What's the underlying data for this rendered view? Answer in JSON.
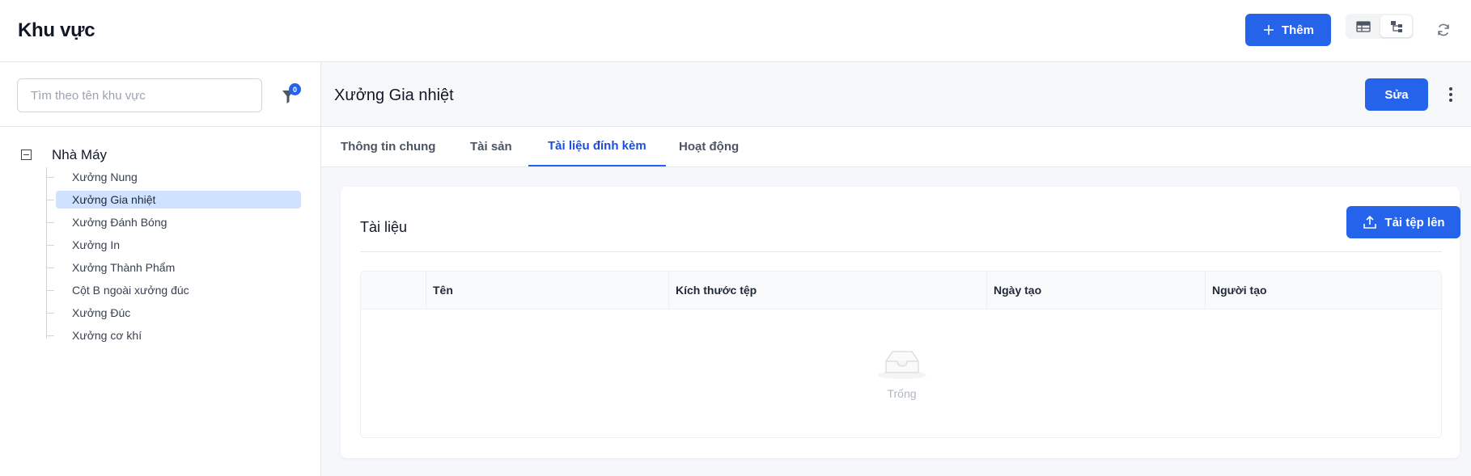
{
  "header": {
    "title": "Khu vực",
    "add_label": "Thêm",
    "view_options": [
      "table-view",
      "tree-view"
    ],
    "active_view": "tree-view"
  },
  "sidebar": {
    "search_placeholder": "Tìm theo tên khu vực",
    "filter_count": "0",
    "tree": {
      "root_label": "Nhà Máy",
      "items": [
        {
          "label": "Xưởng Nung"
        },
        {
          "label": "Xưởng Gia nhiệt",
          "selected": true
        },
        {
          "label": "Xưởng Đánh Bóng"
        },
        {
          "label": "Xưởng In"
        },
        {
          "label": "Xưởng Thành Phẩm"
        },
        {
          "label": "Cột B ngoài xưởng đúc"
        },
        {
          "label": "Xưởng Đúc"
        },
        {
          "label": "Xưởng cơ khí"
        }
      ]
    }
  },
  "detail": {
    "title": "Xưởng Gia nhiệt",
    "edit_label": "Sửa",
    "tabs": [
      {
        "label": "Thông tin chung"
      },
      {
        "label": "Tài sản"
      },
      {
        "label": "Tài liệu đính kèm",
        "active": true
      },
      {
        "label": "Hoạt động"
      }
    ],
    "documents": {
      "title": "Tài liệu",
      "upload_label": "Tải tệp lên",
      "columns": [
        "",
        "Tên",
        "Kích thước tệp",
        "Ngày tạo",
        "Người tạo"
      ],
      "empty_text": "Trống"
    }
  },
  "colors": {
    "primary": "#2563eb",
    "selected_bg": "#cfe2ff",
    "active_tab": "#1d4ed8"
  }
}
